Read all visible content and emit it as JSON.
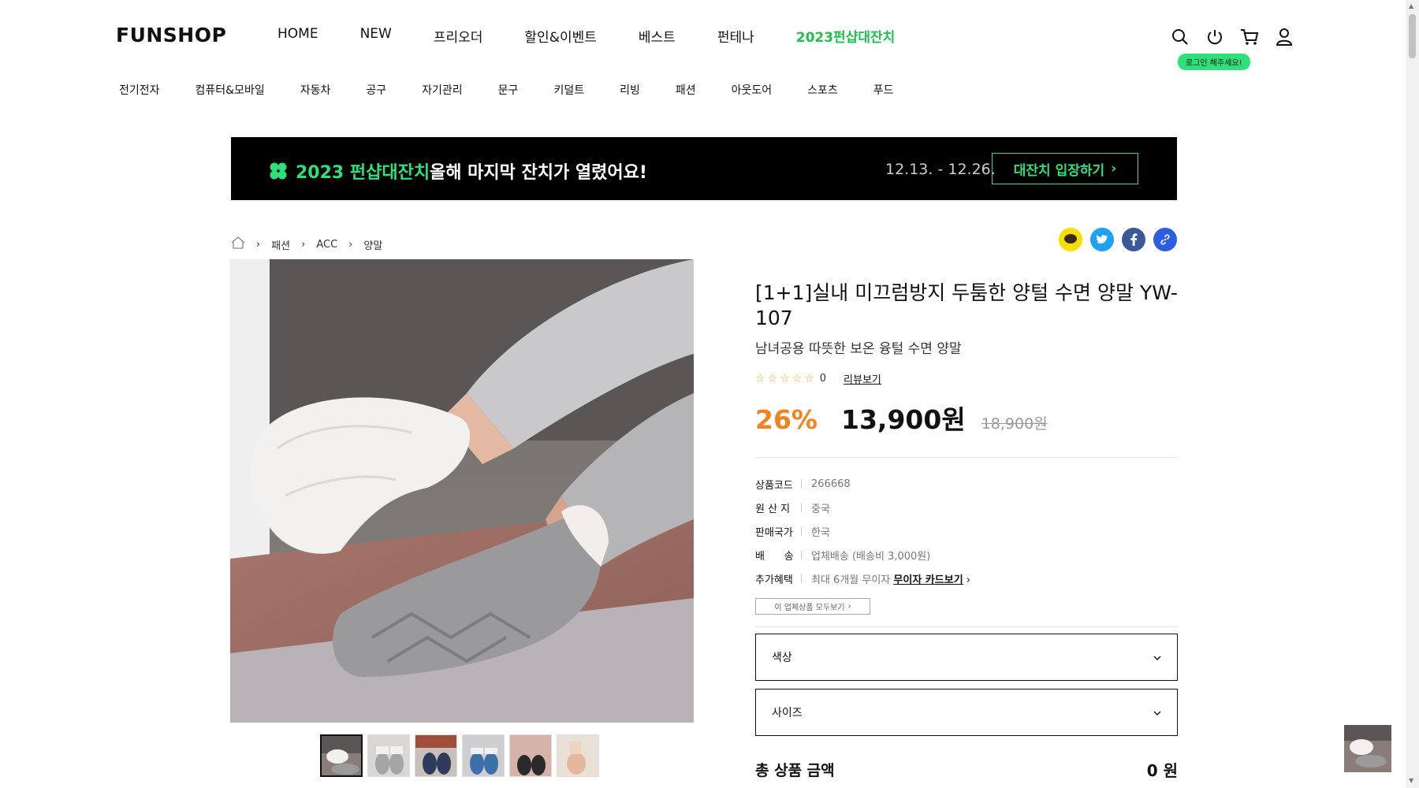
{
  "header": {
    "logo": "FUNSHOP",
    "gnb": [
      "HOME",
      "NEW",
      "프리오더",
      "할인&이벤트",
      "베스트",
      "펀테나",
      "2023펀샵대잔치"
    ],
    "login_badge": "로그인 해주세요!",
    "categories": [
      "전기전자",
      "컴퓨터&모바일",
      "자동차",
      "공구",
      "자기관리",
      "문구",
      "키덜트",
      "리빙",
      "패션",
      "아웃도어",
      "스포츠",
      "푸드"
    ]
  },
  "banner": {
    "title": "2023 펀샵대잔치",
    "subtitle": "올해 마지막 잔치가 열렸어요!",
    "date": "12.13. - 12.26.",
    "button": "대잔치 입장하기"
  },
  "breadcrumb": [
    "패션",
    "ACC",
    "양말"
  ],
  "product": {
    "title": "[1+1]실내 미끄럼방지 두툼한 양털 수면 양말 YW-107",
    "subtitle": "남녀공용 따뜻한 보온 융털 수면 양말",
    "stars": "☆☆☆☆☆",
    "review_count": "0",
    "review_link": "리뷰보기",
    "discount": "26%",
    "price": "13,900원",
    "original_price": "18,900원",
    "specs": {
      "code_label": "상품코드",
      "code": "266668",
      "origin_label": "원 산 지",
      "origin": "중국",
      "country_label": "판매국가",
      "country": "한국",
      "ship_label": "배      송",
      "ship": "업체배송 (배송비 3,000원)",
      "benefit_label": "추가혜택",
      "benefit": "최대 6개월 무이자",
      "benefit_link": "무이자 카드보기"
    },
    "vendor_button": "이 업체상품 모두보기",
    "options": [
      {
        "label": "색상"
      },
      {
        "label": "사이즈"
      }
    ],
    "total_label": "총 상품 금액",
    "total_amount": "0 원"
  },
  "colors": {
    "accent_green": "#2ee07a",
    "discount_orange": "#f5821f"
  }
}
